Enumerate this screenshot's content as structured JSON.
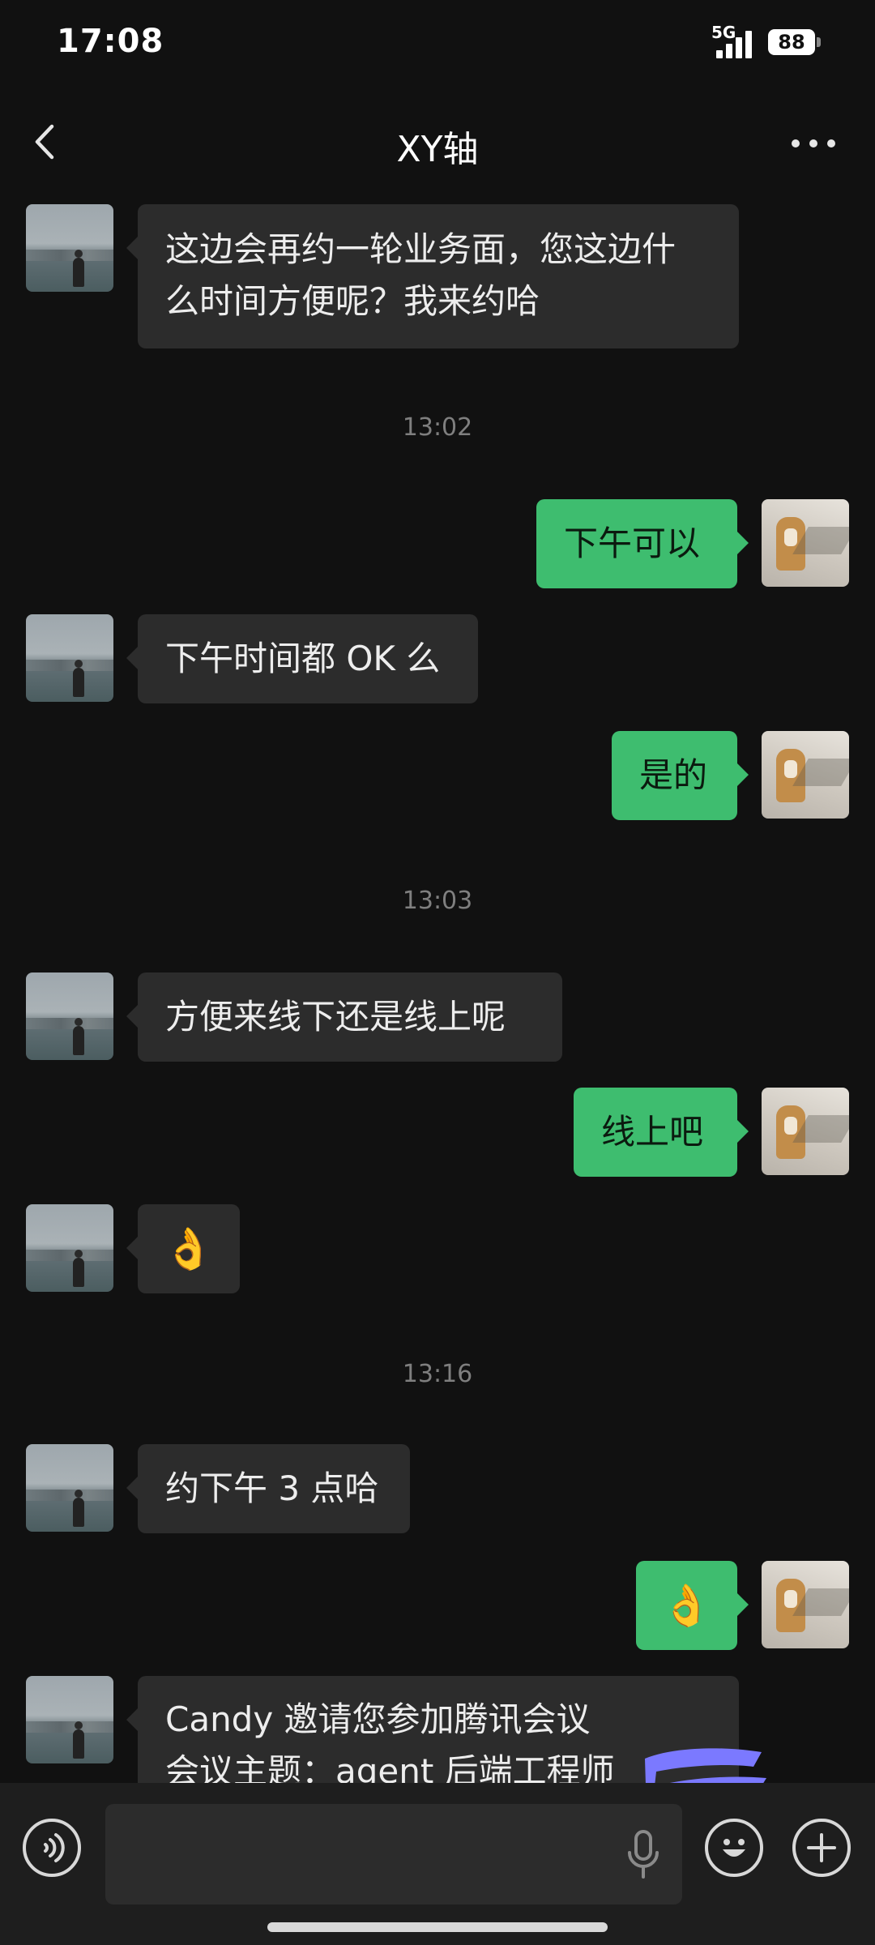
{
  "status_bar": {
    "time": "17:08",
    "network": "5G",
    "battery": "88"
  },
  "nav": {
    "title": "XY轴"
  },
  "messages": [
    {
      "side": "left",
      "text": "这边会再约一轮业务面，您这边什\n么时间方便呢？我来约哈"
    },
    {
      "type": "time",
      "text": "13:02"
    },
    {
      "side": "right",
      "text": "下午可以"
    },
    {
      "side": "left",
      "text": "下午时间都 OK 么"
    },
    {
      "side": "right",
      "text": "是的"
    },
    {
      "type": "time",
      "text": "13:03"
    },
    {
      "side": "left",
      "text": "方便来线下还是线上呢"
    },
    {
      "side": "right",
      "text": "线上吧"
    },
    {
      "side": "left",
      "text": "👌"
    },
    {
      "type": "time",
      "text": "13:16"
    },
    {
      "side": "left",
      "text": "约下午 3 点哈"
    },
    {
      "side": "right",
      "text": "👌"
    },
    {
      "side": "left",
      "text": "Candy 邀请您参加腾讯会议\n会议主题：agent 后端工程师"
    }
  ],
  "input_bar": {
    "placeholder": ""
  },
  "icons": {
    "back": "chevron-left-icon",
    "more": "more-horizontal-icon",
    "voice": "voice-toggle-icon",
    "mic": "microphone-icon",
    "emoji": "emoji-icon",
    "plus": "plus-icon"
  },
  "colors": {
    "background": "#111111",
    "bubble_incoming": "#2c2c2c",
    "bubble_outgoing": "#3ebd6f",
    "redaction": "#7b79ff"
  }
}
